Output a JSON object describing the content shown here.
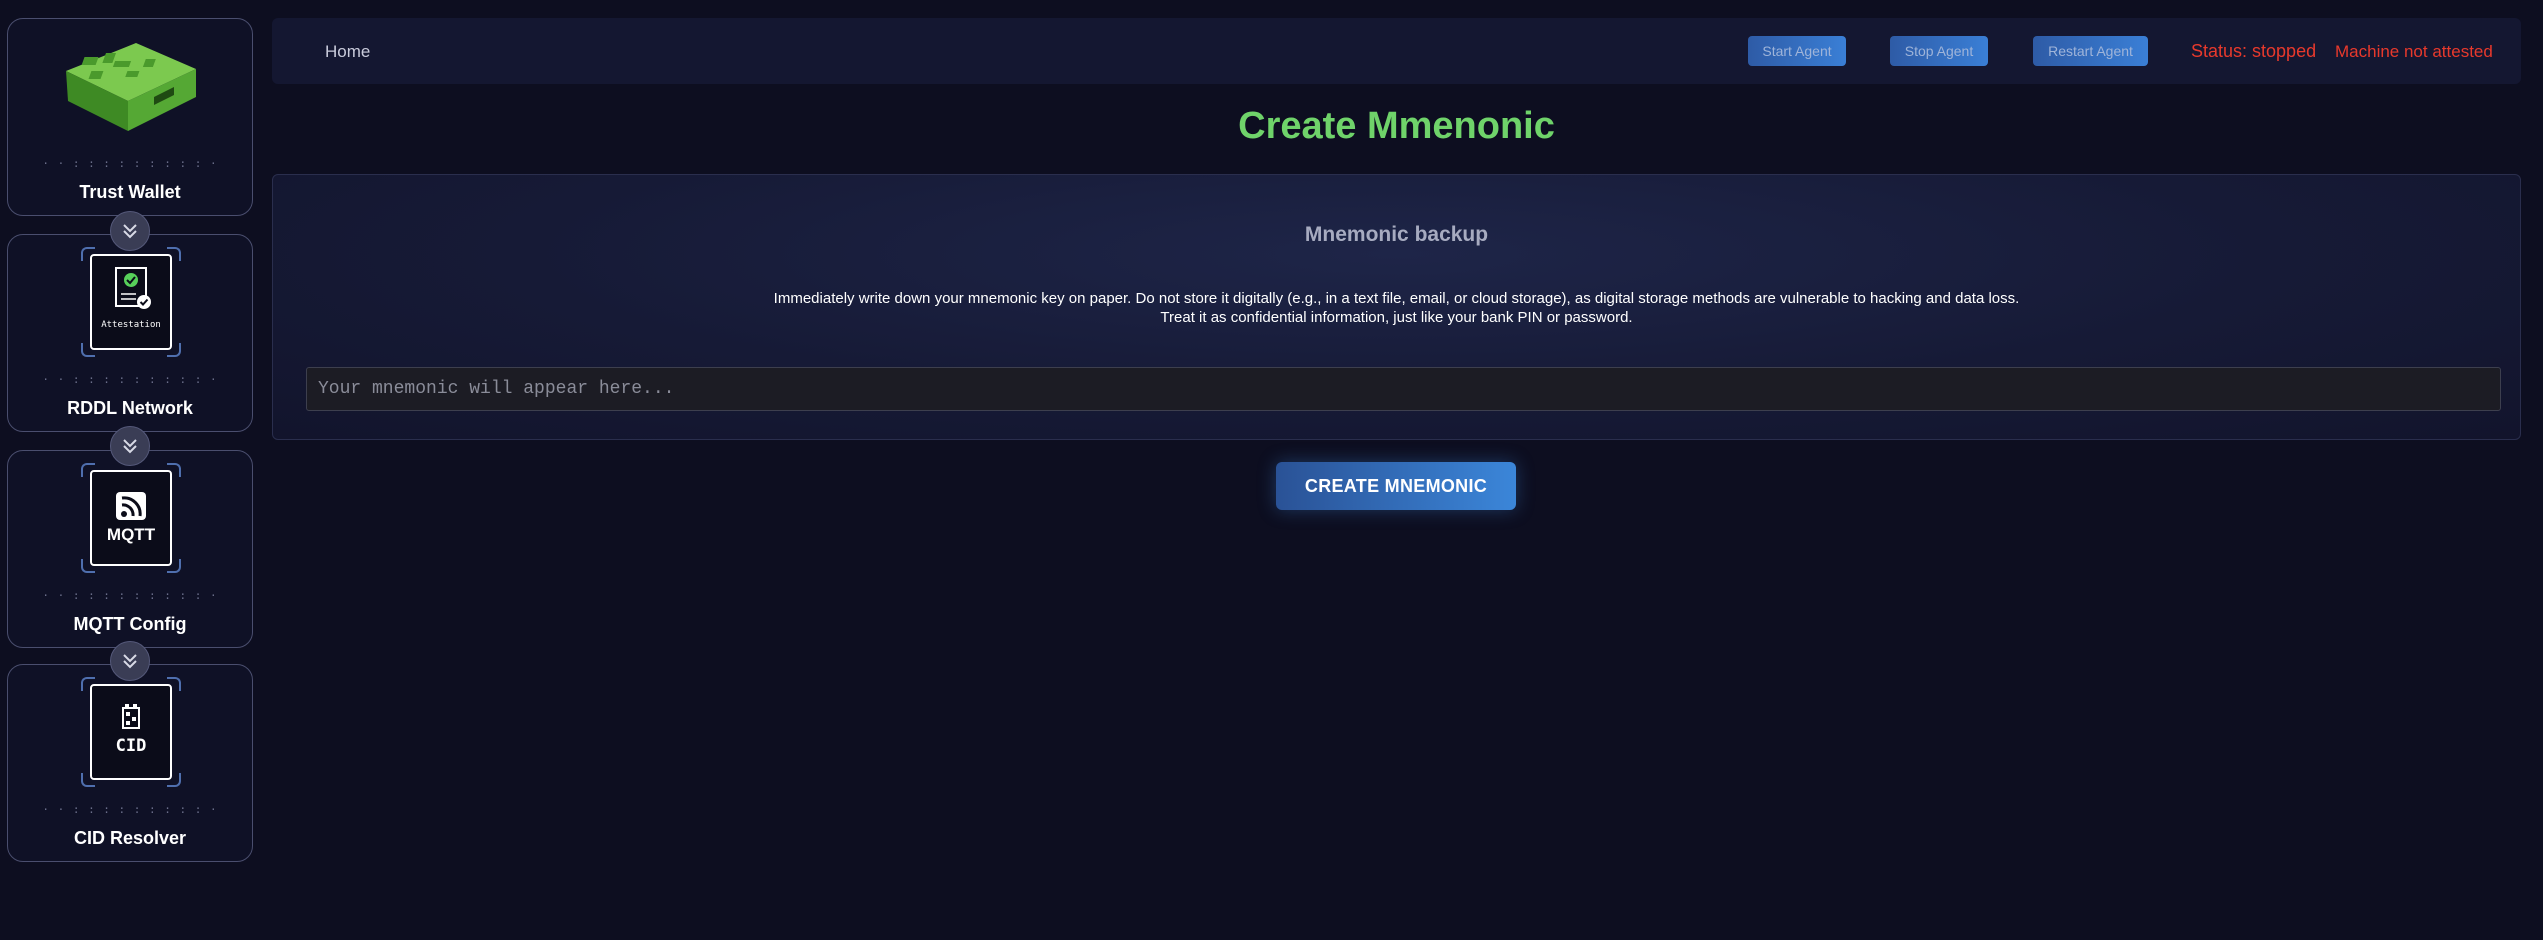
{
  "sidebar": {
    "items": [
      {
        "label": "Trust Wallet",
        "dots": "· · :  : : : :  : : : :  ·",
        "icon": "green-hardware-device-image"
      },
      {
        "label": "RDDL Network",
        "dots": "· · :  : : : :  : : : :  ·",
        "icon": "attestation-icon",
        "icon_caption": "Attestation"
      },
      {
        "label": "MQTT Config",
        "dots": "· · :  : : : :  : : : :  ·",
        "icon": "mqtt-icon",
        "icon_caption": "MQTT"
      },
      {
        "label": "CID Resolver",
        "dots": "· · :  : : : :  : : : :  ·",
        "icon": "cid-icon",
        "icon_caption": "CID"
      }
    ],
    "connector_icon": "double-chevron-down-icon"
  },
  "topbar": {
    "home_label": "Home",
    "start_label": "Start Agent",
    "stop_label": "Stop Agent",
    "restart_label": "Restart Agent",
    "status_text": "Status: stopped",
    "attest_text": "Machine not attested"
  },
  "main": {
    "title": "Create Mmenonic",
    "panel_heading": "Mnemonic backup",
    "warning_line1": "Immediately write down your mnemonic key on paper. Do not store it digitally (e.g., in a text file, email, or cloud storage), as digital storage methods are vulnerable to hacking and data loss.",
    "warning_line2": "Treat it as confidential information, just like your bank PIN or password.",
    "mnemonic_placeholder": "Your mnemonic will appear here...",
    "mnemonic_value": "",
    "create_button_label": "CREATE MNEMONIC"
  },
  "colors": {
    "background": "#0d0e20",
    "title_green": "#6fd36a",
    "status_red": "#e8392c",
    "button_blue": "#3b86d9",
    "device_green": "#5fb83a"
  }
}
